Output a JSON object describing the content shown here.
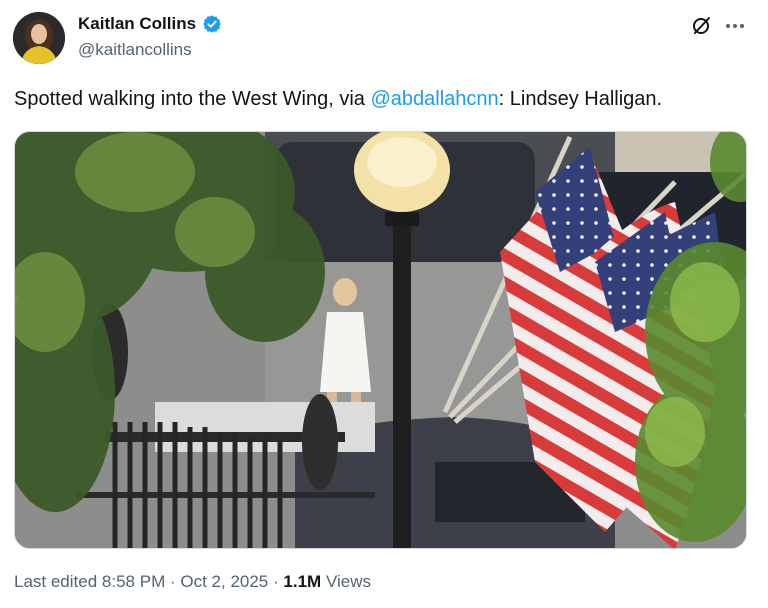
{
  "author": {
    "display_name": "Kaitlan Collins",
    "handle": "@kaitlancollins",
    "verified": true
  },
  "tweet": {
    "text_before": "Spotted walking into the West Wing, via ",
    "mention": "@abdallahcnn",
    "text_after": ": Lindsey Halligan."
  },
  "meta": {
    "edited_label": "Last edited",
    "time": "8:58 PM",
    "separator": "·",
    "date": "Oct 2, 2025",
    "views_count": "1.1M",
    "views_label": "Views"
  },
  "icons": {
    "verified": "verified-badge-icon",
    "grok": "grok-icon",
    "more": "more-icon"
  },
  "colors": {
    "link": "#1d9bf0",
    "secondary_text": "#536471",
    "primary_text": "#0f1419",
    "verified": "#1d9bf0"
  }
}
